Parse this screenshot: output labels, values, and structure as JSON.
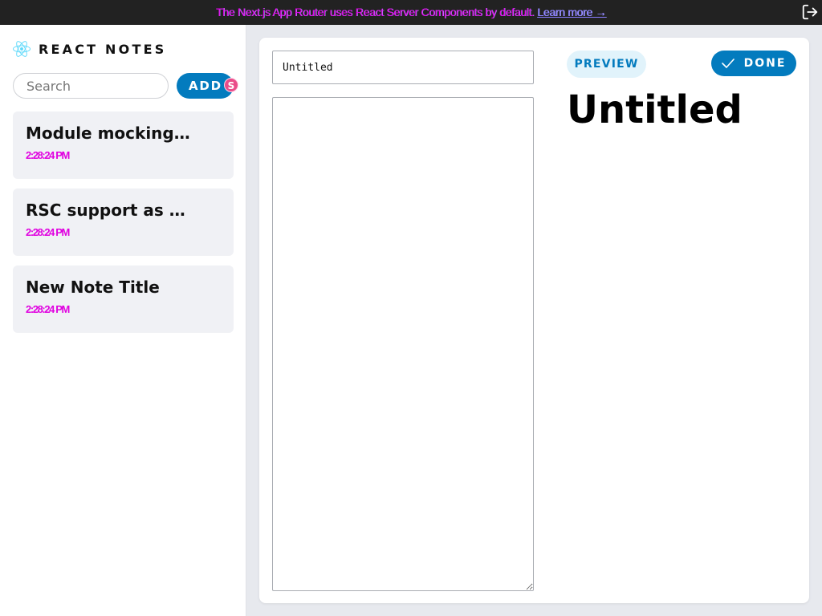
{
  "banner": {
    "text": "The Next.js App Router uses React Server Components by default.",
    "link_label": "Learn more →",
    "colors": {
      "background": "#222222",
      "text": "#e100e8"
    }
  },
  "icons": {
    "logout": "logout-icon",
    "logo": "react-logo-icon",
    "check": "check-icon"
  },
  "sidebar": {
    "brand_title": "REACT NOTES",
    "search_placeholder": "Search",
    "add_label": "ADD",
    "add_badge": "S",
    "notes": [
      {
        "title": "Module mocking…",
        "time": "2:28:24 PM"
      },
      {
        "title": "RSC support as …",
        "time": "2:28:24 PM"
      },
      {
        "title": "New Note Title",
        "time": "2:28:24 PM"
      }
    ]
  },
  "editor": {
    "title_value": "Untitled",
    "body_value": "",
    "preview_label": "PREVIEW",
    "done_label": "DONE",
    "preview_title": "Untitled"
  },
  "colors": {
    "accent": "#037bbe",
    "preview_bg": "#e1f3fb",
    "note_bg": "#f0f1f5",
    "badge": "#ea4c89"
  }
}
